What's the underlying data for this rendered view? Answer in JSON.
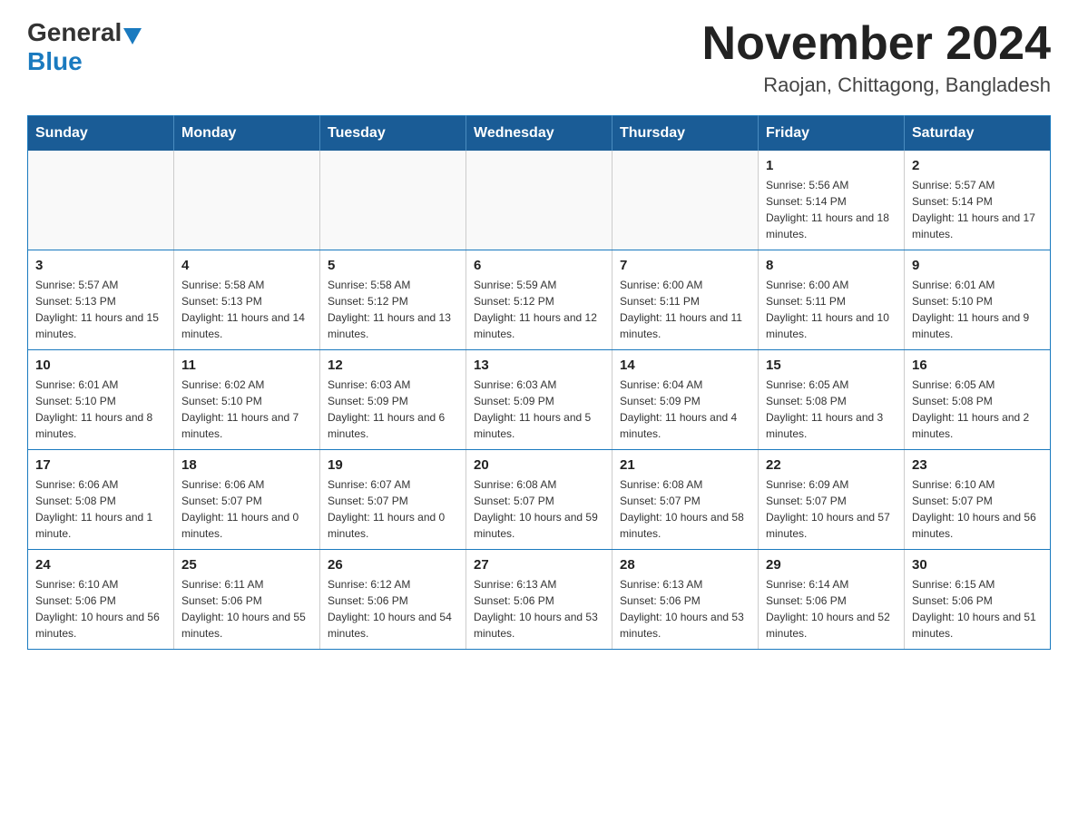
{
  "header": {
    "logo_general": "General",
    "logo_blue": "Blue",
    "month_title": "November 2024",
    "location": "Raojan, Chittagong, Bangladesh"
  },
  "calendar": {
    "days_of_week": [
      "Sunday",
      "Monday",
      "Tuesday",
      "Wednesday",
      "Thursday",
      "Friday",
      "Saturday"
    ],
    "weeks": [
      [
        {
          "day": "",
          "info": ""
        },
        {
          "day": "",
          "info": ""
        },
        {
          "day": "",
          "info": ""
        },
        {
          "day": "",
          "info": ""
        },
        {
          "day": "",
          "info": ""
        },
        {
          "day": "1",
          "info": "Sunrise: 5:56 AM\nSunset: 5:14 PM\nDaylight: 11 hours and 18 minutes."
        },
        {
          "day": "2",
          "info": "Sunrise: 5:57 AM\nSunset: 5:14 PM\nDaylight: 11 hours and 17 minutes."
        }
      ],
      [
        {
          "day": "3",
          "info": "Sunrise: 5:57 AM\nSunset: 5:13 PM\nDaylight: 11 hours and 15 minutes."
        },
        {
          "day": "4",
          "info": "Sunrise: 5:58 AM\nSunset: 5:13 PM\nDaylight: 11 hours and 14 minutes."
        },
        {
          "day": "5",
          "info": "Sunrise: 5:58 AM\nSunset: 5:12 PM\nDaylight: 11 hours and 13 minutes."
        },
        {
          "day": "6",
          "info": "Sunrise: 5:59 AM\nSunset: 5:12 PM\nDaylight: 11 hours and 12 minutes."
        },
        {
          "day": "7",
          "info": "Sunrise: 6:00 AM\nSunset: 5:11 PM\nDaylight: 11 hours and 11 minutes."
        },
        {
          "day": "8",
          "info": "Sunrise: 6:00 AM\nSunset: 5:11 PM\nDaylight: 11 hours and 10 minutes."
        },
        {
          "day": "9",
          "info": "Sunrise: 6:01 AM\nSunset: 5:10 PM\nDaylight: 11 hours and 9 minutes."
        }
      ],
      [
        {
          "day": "10",
          "info": "Sunrise: 6:01 AM\nSunset: 5:10 PM\nDaylight: 11 hours and 8 minutes."
        },
        {
          "day": "11",
          "info": "Sunrise: 6:02 AM\nSunset: 5:10 PM\nDaylight: 11 hours and 7 minutes."
        },
        {
          "day": "12",
          "info": "Sunrise: 6:03 AM\nSunset: 5:09 PM\nDaylight: 11 hours and 6 minutes."
        },
        {
          "day": "13",
          "info": "Sunrise: 6:03 AM\nSunset: 5:09 PM\nDaylight: 11 hours and 5 minutes."
        },
        {
          "day": "14",
          "info": "Sunrise: 6:04 AM\nSunset: 5:09 PM\nDaylight: 11 hours and 4 minutes."
        },
        {
          "day": "15",
          "info": "Sunrise: 6:05 AM\nSunset: 5:08 PM\nDaylight: 11 hours and 3 minutes."
        },
        {
          "day": "16",
          "info": "Sunrise: 6:05 AM\nSunset: 5:08 PM\nDaylight: 11 hours and 2 minutes."
        }
      ],
      [
        {
          "day": "17",
          "info": "Sunrise: 6:06 AM\nSunset: 5:08 PM\nDaylight: 11 hours and 1 minute."
        },
        {
          "day": "18",
          "info": "Sunrise: 6:06 AM\nSunset: 5:07 PM\nDaylight: 11 hours and 0 minutes."
        },
        {
          "day": "19",
          "info": "Sunrise: 6:07 AM\nSunset: 5:07 PM\nDaylight: 11 hours and 0 minutes."
        },
        {
          "day": "20",
          "info": "Sunrise: 6:08 AM\nSunset: 5:07 PM\nDaylight: 10 hours and 59 minutes."
        },
        {
          "day": "21",
          "info": "Sunrise: 6:08 AM\nSunset: 5:07 PM\nDaylight: 10 hours and 58 minutes."
        },
        {
          "day": "22",
          "info": "Sunrise: 6:09 AM\nSunset: 5:07 PM\nDaylight: 10 hours and 57 minutes."
        },
        {
          "day": "23",
          "info": "Sunrise: 6:10 AM\nSunset: 5:07 PM\nDaylight: 10 hours and 56 minutes."
        }
      ],
      [
        {
          "day": "24",
          "info": "Sunrise: 6:10 AM\nSunset: 5:06 PM\nDaylight: 10 hours and 56 minutes."
        },
        {
          "day": "25",
          "info": "Sunrise: 6:11 AM\nSunset: 5:06 PM\nDaylight: 10 hours and 55 minutes."
        },
        {
          "day": "26",
          "info": "Sunrise: 6:12 AM\nSunset: 5:06 PM\nDaylight: 10 hours and 54 minutes."
        },
        {
          "day": "27",
          "info": "Sunrise: 6:13 AM\nSunset: 5:06 PM\nDaylight: 10 hours and 53 minutes."
        },
        {
          "day": "28",
          "info": "Sunrise: 6:13 AM\nSunset: 5:06 PM\nDaylight: 10 hours and 53 minutes."
        },
        {
          "day": "29",
          "info": "Sunrise: 6:14 AM\nSunset: 5:06 PM\nDaylight: 10 hours and 52 minutes."
        },
        {
          "day": "30",
          "info": "Sunrise: 6:15 AM\nSunset: 5:06 PM\nDaylight: 10 hours and 51 minutes."
        }
      ]
    ]
  }
}
